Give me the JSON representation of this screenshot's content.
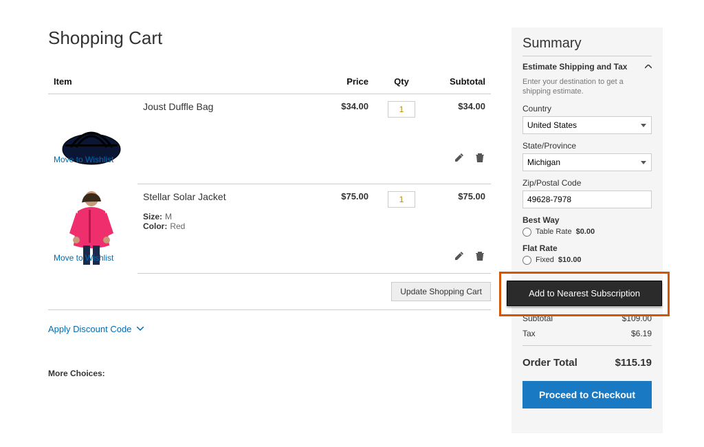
{
  "page": {
    "title": "Shopping Cart"
  },
  "cart": {
    "columns": {
      "item": "Item",
      "price": "Price",
      "qty": "Qty",
      "subtotal": "Subtotal"
    },
    "items": [
      {
        "name": "Joust Duffle Bag",
        "price": "$34.00",
        "qty": "1",
        "subtotal": "$34.00",
        "attrs": [],
        "image": "duffle"
      },
      {
        "name": "Stellar Solar Jacket",
        "price": "$75.00",
        "qty": "1",
        "subtotal": "$75.00",
        "attrs": [
          {
            "label": "Size:",
            "value": "M"
          },
          {
            "label": "Color:",
            "value": "Red"
          }
        ],
        "image": "jacket"
      }
    ],
    "move_to_wishlist": "Move to Wishlist",
    "update_cart": "Update Shopping Cart",
    "apply_discount": "Apply Discount Code",
    "more_choices": "More Choices:"
  },
  "summary": {
    "title": "Summary",
    "estimate": {
      "heading": "Estimate Shipping and Tax",
      "hint": "Enter your destination to get a shipping estimate.",
      "country_label": "Country",
      "country": "United States",
      "state_label": "State/Province",
      "state": "Michigan",
      "zip_label": "Zip/Postal Code",
      "zip": "49628-7978"
    },
    "shipping": [
      {
        "title": "Best Way",
        "option": "Table Rate",
        "price": "$0.00"
      },
      {
        "title": "Flat Rate",
        "option": "Fixed",
        "price": "$10.00"
      }
    ],
    "add_sub": "Add to Nearest Subscription",
    "subtotal_label": "Subtotal",
    "subtotal": "$109.00",
    "tax_label": "Tax",
    "tax": "$6.19",
    "order_total_label": "Order Total",
    "order_total": "$115.19",
    "checkout": "Proceed to Checkout"
  }
}
